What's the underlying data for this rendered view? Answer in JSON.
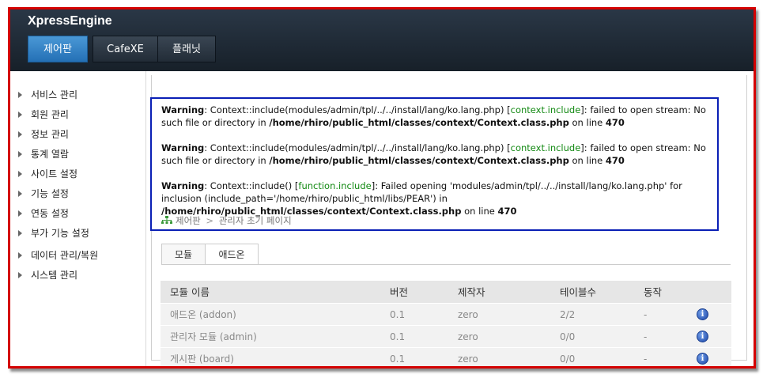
{
  "header": {
    "app_title": "XpressEngine",
    "tabs": [
      {
        "label": "제어판",
        "active": true
      },
      {
        "label": "CafeXE",
        "active": false
      },
      {
        "label": "플래닛",
        "active": false
      }
    ]
  },
  "sidebar": {
    "items": [
      {
        "label": "서비스 관리"
      },
      {
        "label": "회원 관리"
      },
      {
        "label": "정보 관리"
      },
      {
        "label": "통계 열람"
      },
      {
        "label": "사이트 설정"
      },
      {
        "label": "기능 설정"
      },
      {
        "label": "연동 설정"
      },
      {
        "label": "부가 기능 설정"
      },
      {
        "label": "데이터 관리/복원"
      },
      {
        "label": "시스템 관리"
      }
    ]
  },
  "warnings": [
    {
      "label": "Warning",
      "text1": ": Context::include(modules/admin/tpl/../../install/lang/ko.lang.php) [",
      "link": "context.include",
      "text2": "]: failed to open stream: No such file or directory in ",
      "path": "/home/rhiro/public_html/classes/context/Context.class.php",
      "online": " on line ",
      "line": "470"
    },
    {
      "label": "Warning",
      "text1": ": Context::include(modules/admin/tpl/../../install/lang/ko.lang.php) [",
      "link": "context.include",
      "text2": "]: failed to open stream: No such file or directory in ",
      "path": "/home/rhiro/public_html/classes/context/Context.class.php",
      "online": " on line ",
      "line": "470"
    },
    {
      "label": "Warning",
      "text1": ": Context::include() [",
      "link": "function.include",
      "text2": "]: Failed opening 'modules/admin/tpl/../../install/lang/ko.lang.php' for inclusion (include_path='/home/rhiro/public_html/libs/PEAR') in ",
      "path": "/home/rhiro/public_html/classes/context/Context.class.php",
      "online": " on line ",
      "line": "470"
    }
  ],
  "breadcrumb": {
    "root": "제어판",
    "separator": ">",
    "current": "관리자 초기 페이지"
  },
  "subtabs": [
    {
      "label": "모듈",
      "active": true
    },
    {
      "label": "애드온",
      "active": false
    }
  ],
  "table": {
    "headers": [
      "모듈 이름",
      "버전",
      "제작자",
      "테이블수",
      "동작"
    ],
    "rows": [
      {
        "name": "애드온 (addon)",
        "version": "0.1",
        "author": "zero",
        "tables": "2/2",
        "action": "-"
      },
      {
        "name": "관리자 모듈 (admin)",
        "version": "0.1",
        "author": "zero",
        "tables": "0/0",
        "action": "-"
      },
      {
        "name": "게시판 (board)",
        "version": "0.1",
        "author": "zero",
        "tables": "0/0",
        "action": "-"
      }
    ]
  },
  "colors": {
    "header_bg": "#1c2631",
    "active_tab": "#3585c7",
    "frame_border": "#d40000",
    "warning_border": "#0a1fb5",
    "link_green": "#148a14"
  }
}
